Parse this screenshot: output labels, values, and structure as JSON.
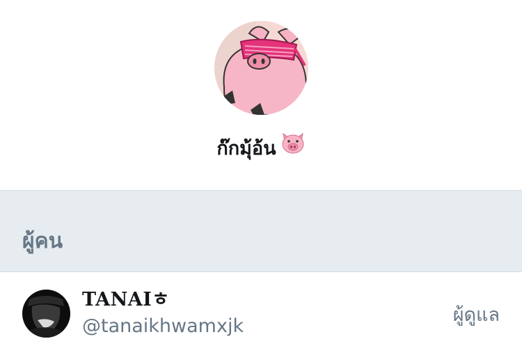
{
  "group": {
    "name": "ก๊กมุ้อ้น",
    "emoji_icon": "pig-face-icon"
  },
  "members_section": {
    "title": "ผู้คน"
  },
  "members": [
    {
      "name": "TANAIㅎ",
      "handle": "@tanaikhwamxjk",
      "role": "ผู้ดูแล"
    }
  ],
  "colors": {
    "section_bg": "#e6ecf0",
    "secondary_text": "#657786",
    "primary_text": "#14171a"
  }
}
